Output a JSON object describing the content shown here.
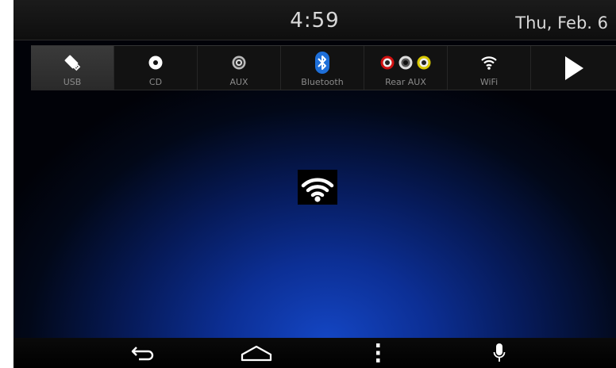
{
  "status": {
    "time": "4:59",
    "date": "Thu, Feb. 6"
  },
  "sources": [
    {
      "label": "USB",
      "icon": "usb-drive-icon",
      "active": true
    },
    {
      "label": "CD",
      "icon": "disc-icon",
      "active": false
    },
    {
      "label": "AUX",
      "icon": "aux-jack-icon",
      "active": false
    },
    {
      "label": "Bluetooth",
      "icon": "bluetooth-icon",
      "active": false
    },
    {
      "label": "Rear AUX",
      "icon": "rca-jacks-icon",
      "active": false
    },
    {
      "label": "WiFi",
      "icon": "wifi-icon",
      "active": false
    }
  ],
  "next_icon": "play-arrow-icon",
  "main": {
    "icon": "wifi-icon"
  },
  "nav": [
    "back-icon",
    "home-icon",
    "menu-icon",
    "microphone-icon"
  ],
  "colors": {
    "accent_blue": "#0c2f95",
    "bluetooth_blue": "#1e6fd9",
    "rca_red": "#d01010",
    "rca_yellow": "#d8c800"
  }
}
